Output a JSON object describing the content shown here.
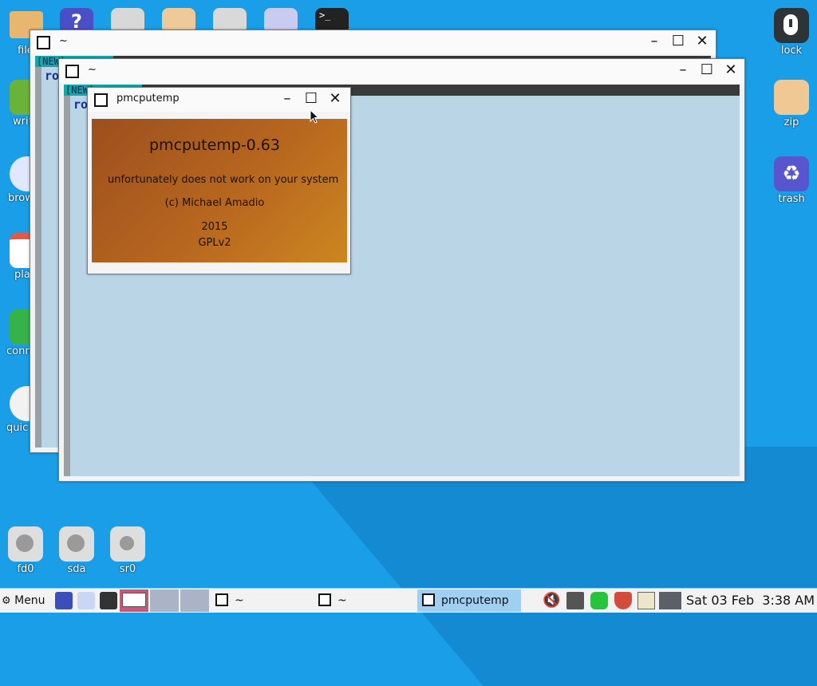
{
  "desktop": {
    "left_icons": [
      {
        "name": "file-manager",
        "label": "file"
      },
      {
        "name": "write",
        "label": "writ"
      },
      {
        "name": "browser",
        "label": "brow"
      },
      {
        "name": "planner",
        "label": "pla"
      },
      {
        "name": "connect",
        "label": "conn"
      },
      {
        "name": "quickpet",
        "label": "quic"
      }
    ],
    "right_icons": [
      {
        "name": "lock",
        "label": "lock"
      },
      {
        "name": "zip",
        "label": "zip"
      },
      {
        "name": "trash",
        "label": "trash"
      }
    ],
    "drive_icons": [
      {
        "name": "fd0",
        "label": "fd0"
      },
      {
        "name": "sda",
        "label": "sda"
      },
      {
        "name": "sr0",
        "label": "sr0"
      }
    ]
  },
  "windows": {
    "term_back": {
      "title": "~",
      "status": "[NEW]",
      "prompt": "ro"
    },
    "term_front": {
      "title": "~",
      "status": "[NEW]",
      "prompt": "ro"
    },
    "dialog": {
      "title": "pmcputemp",
      "heading": "pmcputemp-0.63",
      "message": "unfortunately does not work on your system",
      "copyright": "(c) Michael Amadio",
      "year": "2015",
      "license": "GPLv2"
    }
  },
  "taskbar": {
    "menu_label": "Menu",
    "tasks": [
      {
        "label": "~"
      },
      {
        "label": "~"
      },
      {
        "label": "pmcputemp"
      }
    ],
    "clock": "Sat 03 Feb  3:38 AM"
  },
  "colors": {
    "desktop": "#1a9ee8",
    "dialog_gradient_start": "#9c4f1e",
    "dialog_gradient_end": "#cc8620",
    "active_task": "#9fd0f2"
  }
}
